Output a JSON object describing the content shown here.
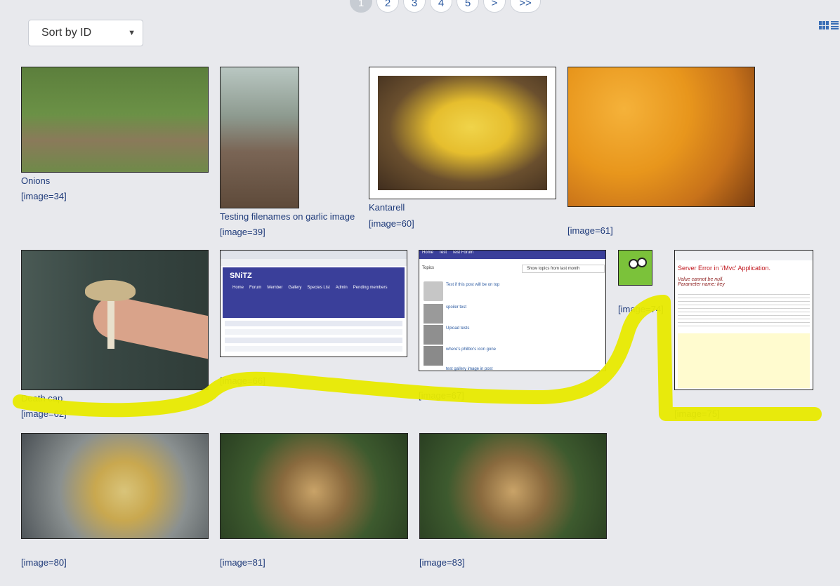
{
  "pagination": {
    "pages": [
      "1",
      "2",
      "3",
      "4",
      "5",
      ">",
      ">>"
    ],
    "active": "1"
  },
  "sort": {
    "selected": "Sort by ID"
  },
  "view_icons": [
    "grid-view-icon",
    "list-view-icon"
  ],
  "gallery": {
    "items": [
      {
        "title": "Onions",
        "tag": "[image=34]"
      },
      {
        "title": "Testing filenames on garlic image",
        "tag": "[image=39]"
      },
      {
        "title": "Kantarell",
        "tag": "[image=60]"
      },
      {
        "title": "",
        "tag": "[image=61]"
      },
      {
        "title": "Death cap",
        "tag": "[image=62]"
      },
      {
        "title": "",
        "tag": "[image=66]"
      },
      {
        "title": "",
        "tag": "[image=67]"
      },
      {
        "title": "",
        "tag": "[image=74]"
      },
      {
        "title": "",
        "tag": "[image=75]"
      },
      {
        "title": "",
        "tag": "[image=80]"
      },
      {
        "title": "",
        "tag": "[image=81]"
      },
      {
        "title": "",
        "tag": "[image=83]"
      }
    ]
  },
  "screenshots": {
    "forum_66": {
      "logo": "SNiTZ",
      "nav": [
        "Home",
        "Forum",
        "Member",
        "Gallery",
        "Species List",
        "Admin"
      ],
      "pending": "Pending members"
    },
    "forum_67": {
      "nav": [
        "Home",
        "Test",
        "Test Forum"
      ],
      "heading": "Topics",
      "filter": "Show topics from last month",
      "topics": [
        "Test if this post will be on top",
        "spoiler test",
        "Upload tests",
        "where's philbix's icon gone",
        "test gallery image in post"
      ]
    },
    "error_75": {
      "title": "Server Error in '/Mvc' Application.",
      "subtitle": "Value cannot be null.\nParameter name: key"
    }
  },
  "colors": {
    "highlight": "#e8ea00",
    "link": "#1f3b7a",
    "accent": "#3b6fb6"
  }
}
